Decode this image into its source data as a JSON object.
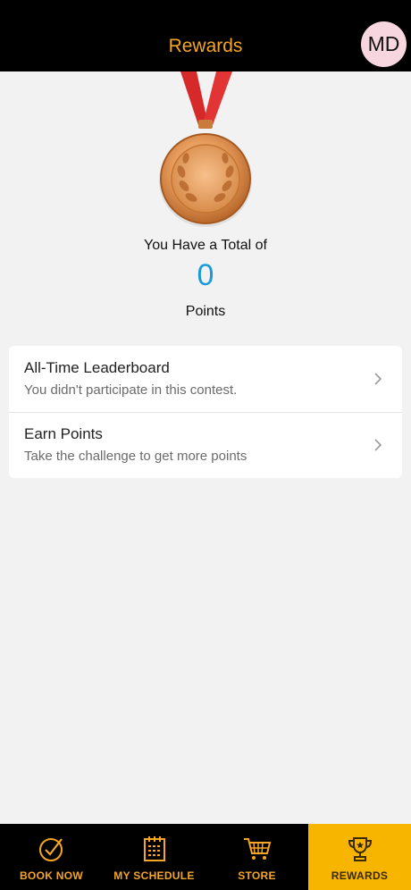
{
  "header": {
    "title": "Rewards",
    "avatar_initials": "MD"
  },
  "rewards": {
    "medal_icon": "bronze-medal-icon",
    "total_label": "You Have a Total of",
    "points_value": "0",
    "points_unit": "Points"
  },
  "list": {
    "items": [
      {
        "title": "All-Time Leaderboard",
        "subtitle": "You didn't participate in this contest."
      },
      {
        "title": "Earn Points",
        "subtitle": "Take the challenge to get more points"
      }
    ]
  },
  "tabs": [
    {
      "label": "BOOK NOW",
      "icon": "check-circle-icon"
    },
    {
      "label": "MY SCHEDULE",
      "icon": "calendar-icon"
    },
    {
      "label": "STORE",
      "icon": "cart-icon"
    },
    {
      "label": "REWARDS",
      "icon": "trophy-icon",
      "active": true
    }
  ],
  "colors": {
    "accent": "#f5a623",
    "active_tab_bg": "#f7b500",
    "points": "#1a9bd7",
    "header_bg": "#000000"
  }
}
